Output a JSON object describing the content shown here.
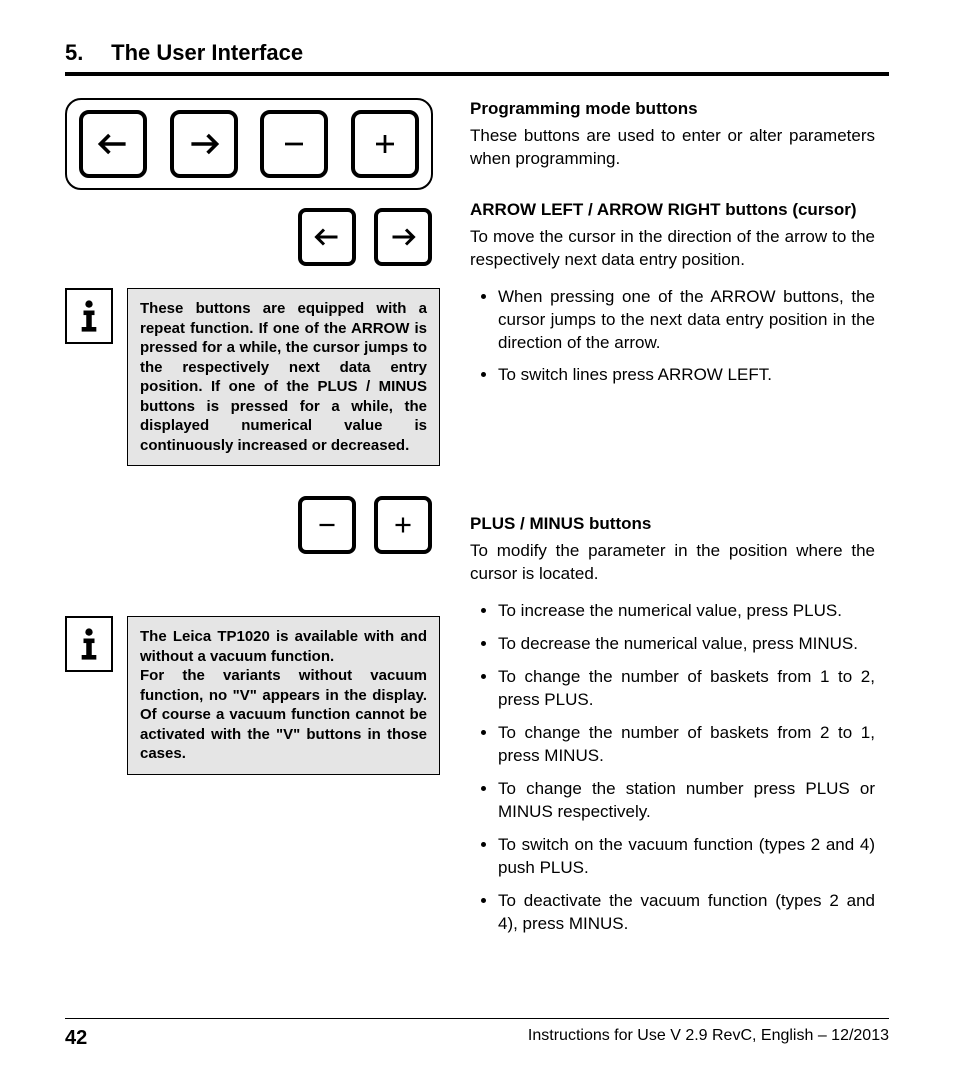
{
  "header": {
    "num": "5.",
    "title": "The User Interface"
  },
  "sections": {
    "prog": {
      "title": "Programming mode buttons",
      "text": "These buttons are used to enter or alter parameters when programming."
    },
    "arrows": {
      "title": "ARROW LEFT / ARROW RIGHT buttons (cursor)",
      "text": "To move the cursor in the direction of the arrow to the respectively next data entry position.",
      "bullets": [
        "When pressing one of the ARROW buttons, the cursor jumps to the next data entry position in the direction of the arrow.",
        "To switch lines press ARROW LEFT."
      ]
    },
    "plusminus": {
      "title": "PLUS / MINUS buttons",
      "text": "To modify the parameter in the position where the cursor is located.",
      "bullets": [
        "To increase the numerical value, press PLUS.",
        "To decrease the numerical value, press MINUS.",
        "To change the number of baskets from 1 to 2, press PLUS.",
        "To change the number of baskets from 2 to 1, press MINUS.",
        "To change the station number press PLUS or MINUS respectively.",
        "To switch on the vacuum function (types 2 and 4) push PLUS.",
        "To deactivate the vacuum function (types 2 and 4), press MINUS."
      ]
    }
  },
  "notes": {
    "repeat": "These buttons are equipped with a repeat function. If one of the ARROW is pressed for a while, the cursor jumps to the respectively next data entry position. If one of the PLUS / MINUS buttons is pressed for a while, the displayed numerical value is continuously increased or decreased.",
    "vacuum_bold": "The Leica TP1020 is available with and without a vacuum function.",
    "vacuum_rest": "For the variants without vacuum function, no \"V\" appears in the display. Of course a vacuum function cannot be activated with the \"V\" buttons in those cases."
  },
  "footer": {
    "page": "42",
    "text": "Instructions for Use V 2.9 RevC, English – 12/2013"
  }
}
